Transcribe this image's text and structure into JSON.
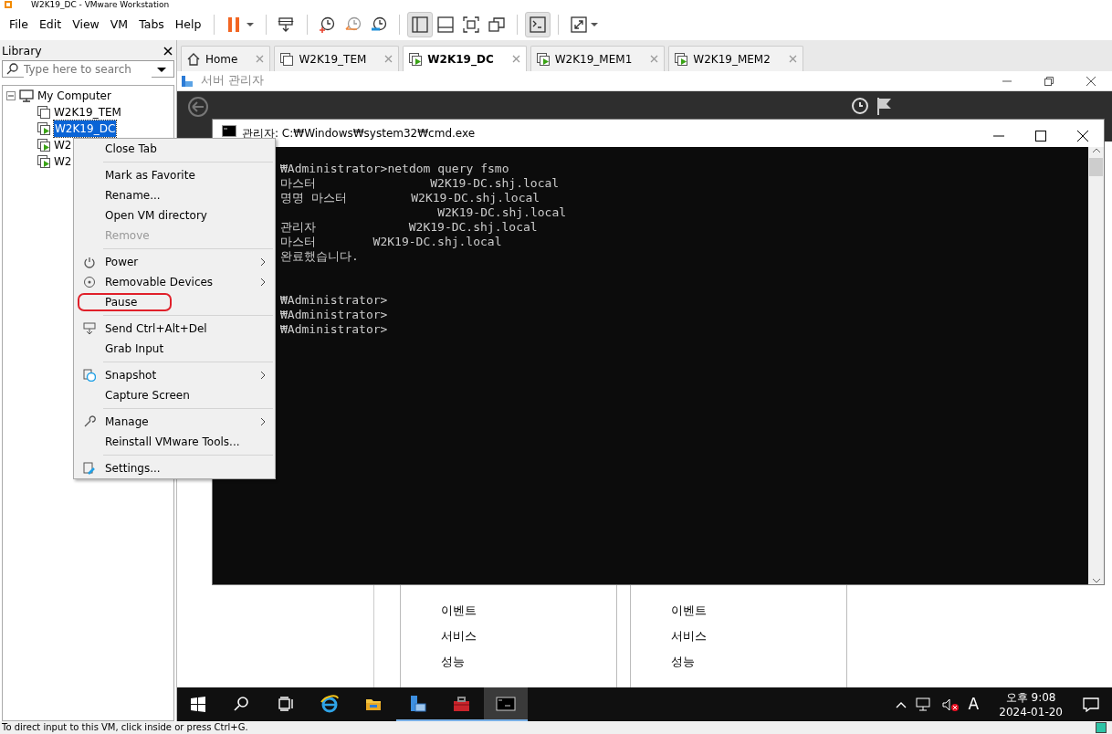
{
  "window": {
    "title": "W2K19_DC - VMware Workstation"
  },
  "menu": [
    {
      "label": "File"
    },
    {
      "label": "Edit"
    },
    {
      "label": "View"
    },
    {
      "label": "VM"
    },
    {
      "label": "Tabs"
    },
    {
      "label": "Help"
    }
  ],
  "toolbar": [
    {
      "kind": "pause",
      "dropdown": true,
      "pressed": false
    },
    {
      "kind": "sep"
    },
    {
      "kind": "send-keys",
      "dropdown": false,
      "pressed": false
    },
    {
      "kind": "sep"
    },
    {
      "kind": "snapshot",
      "dropdown": false,
      "pressed": false
    },
    {
      "kind": "revert",
      "dropdown": false,
      "pressed": false
    },
    {
      "kind": "manage",
      "dropdown": false,
      "pressed": false
    },
    {
      "kind": "sep"
    },
    {
      "kind": "library",
      "dropdown": false,
      "pressed": true
    },
    {
      "kind": "thumbnails",
      "dropdown": false,
      "pressed": false
    },
    {
      "kind": "fullscreen",
      "dropdown": false,
      "pressed": false
    },
    {
      "kind": "unity",
      "dropdown": false,
      "pressed": false
    },
    {
      "kind": "sep"
    },
    {
      "kind": "console",
      "dropdown": false,
      "pressed": true
    },
    {
      "kind": "sep"
    },
    {
      "kind": "stretch",
      "dropdown": true,
      "pressed": false
    }
  ],
  "library": {
    "title": "Library",
    "search": {
      "placeholder": "Type here to search"
    },
    "tree": [
      {
        "label": "My Computer",
        "expanded": true,
        "children": [
          {
            "label": "W2K19_TEM",
            "running": false,
            "selected": false
          },
          {
            "label": "W2K19_DC",
            "running": true,
            "selected": true
          },
          {
            "label": "W2",
            "running": true,
            "selected": false
          },
          {
            "label": "W2",
            "running": true,
            "selected": false
          }
        ]
      }
    ]
  },
  "tabs": [
    {
      "label": "Home",
      "kind": "home",
      "selected": false
    },
    {
      "label": "W2K19_TEM",
      "kind": "vm",
      "running": false,
      "selected": false
    },
    {
      "label": "W2K19_DC",
      "kind": "vm",
      "running": true,
      "selected": true
    },
    {
      "label": "W2K19_MEM1",
      "kind": "vm",
      "running": true,
      "selected": false
    },
    {
      "label": "W2K19_MEM2",
      "kind": "vm",
      "running": true,
      "selected": false
    }
  ],
  "guest": {
    "server_manager": {
      "title": "서버 관리자",
      "tiles": [
        {
          "items": [
            "이벤트",
            "서비스",
            "성능"
          ]
        },
        {
          "items": [
            "이벤트",
            "서비스",
            "성능"
          ]
        }
      ]
    },
    "console": {
      "title": "관리자: C:₩Windows₩system32₩cmd.exe",
      "blocks": [
        [
          "₩Administrator>netdom query fsmo",
          "마스터                W2K19-DC.shj.local",
          "명명 마스터         W2K19-DC.shj.local",
          "                      W2K19-DC.shj.local",
          "관리자             W2K19-DC.shj.local",
          "마스터        W2K19-DC.shj.local",
          "완료했습니다."
        ],
        [
          "₩Administrator>",
          "₩Administrator>",
          "₩Administrator>"
        ]
      ]
    },
    "taskbar": {
      "apps": [
        {
          "kind": "start",
          "running": false,
          "active": false
        },
        {
          "kind": "search",
          "running": false,
          "active": false
        },
        {
          "kind": "taskview",
          "running": false,
          "active": false
        },
        {
          "kind": "browser",
          "running": false,
          "active": false
        },
        {
          "kind": "explorer",
          "running": false,
          "active": false
        },
        {
          "kind": "servermanager",
          "running": true,
          "active": false
        },
        {
          "kind": "toolbox",
          "running": true,
          "active": false
        },
        {
          "kind": "cmd",
          "running": true,
          "active": true
        }
      ],
      "ime": "A",
      "time": "오후 9:08",
      "date": "2024-01-20"
    }
  },
  "context_menu": {
    "groups": [
      [
        {
          "label": "Close Tab",
          "submenu": false,
          "disabled": false,
          "circled": false
        }
      ],
      [
        {
          "label": "Mark as Favorite",
          "submenu": false,
          "disabled": false,
          "circled": false
        },
        {
          "label": "Rename...",
          "submenu": false,
          "disabled": false,
          "circled": false
        },
        {
          "label": "Open VM directory",
          "submenu": false,
          "disabled": false,
          "circled": false
        },
        {
          "label": "Remove",
          "submenu": false,
          "disabled": true,
          "circled": false
        }
      ],
      [
        {
          "label": "Power",
          "submenu": true,
          "disabled": false,
          "circled": false
        },
        {
          "label": "Removable Devices",
          "submenu": true,
          "disabled": false,
          "circled": false
        },
        {
          "label": "Pause",
          "submenu": false,
          "disabled": false,
          "circled": true
        }
      ],
      [
        {
          "label": "Send Ctrl+Alt+Del",
          "submenu": false,
          "disabled": false,
          "circled": false
        },
        {
          "label": "Grab Input",
          "submenu": false,
          "disabled": false,
          "circled": false
        }
      ],
      [
        {
          "label": "Snapshot",
          "submenu": true,
          "disabled": false,
          "circled": false
        },
        {
          "label": "Capture Screen",
          "submenu": false,
          "disabled": false,
          "circled": false
        }
      ],
      [
        {
          "label": "Manage",
          "submenu": true,
          "disabled": false,
          "circled": false
        },
        {
          "label": "Reinstall VMware Tools...",
          "submenu": false,
          "disabled": false,
          "circled": false
        }
      ],
      [
        {
          "label": "Settings...",
          "submenu": false,
          "disabled": false,
          "circled": false
        }
      ]
    ]
  },
  "status_bar": {
    "text": "To direct input to this VM, click inside or press Ctrl+G."
  }
}
